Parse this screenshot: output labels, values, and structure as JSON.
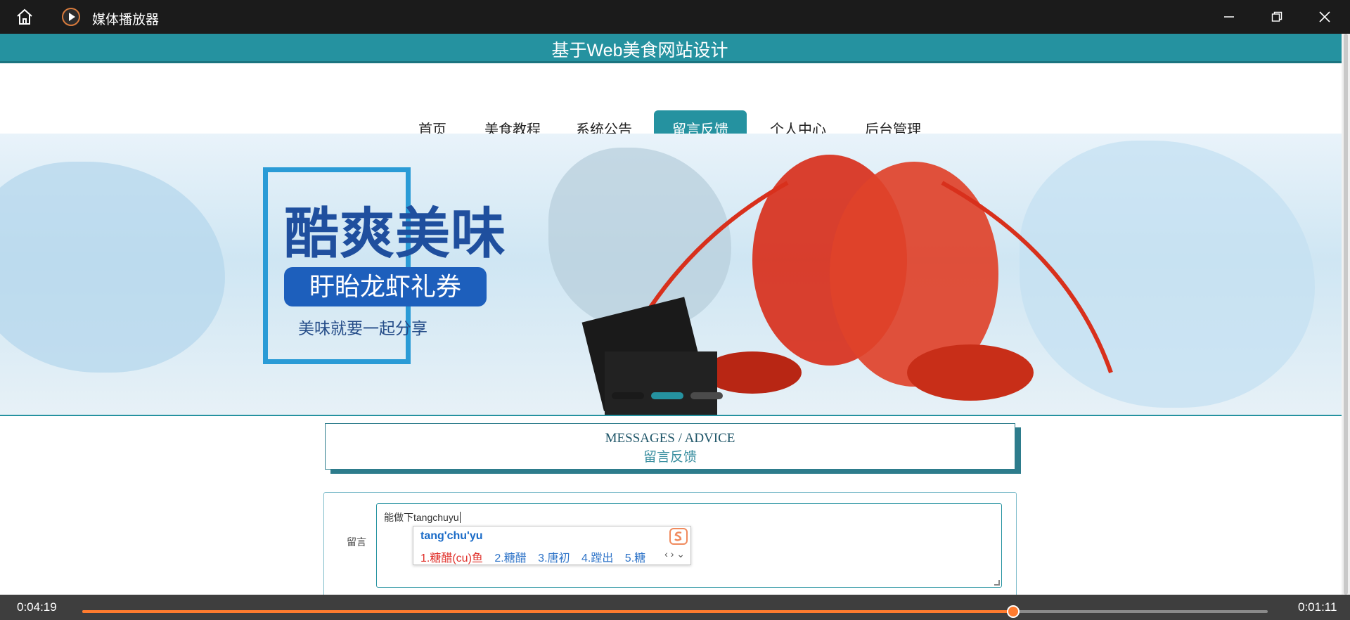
{
  "window": {
    "title": "媒体播放器",
    "minimize_icon": "minimize-icon",
    "maximize_icon": "restore-icon",
    "close_icon": "close-icon"
  },
  "site": {
    "title": "基于Web美食网站设计",
    "accent_color": "#2592a0"
  },
  "nav": {
    "items": [
      {
        "label": "首页"
      },
      {
        "label": "美食教程"
      },
      {
        "label": "系统公告"
      },
      {
        "label": "留言反馈",
        "active": true
      },
      {
        "label": "个人中心"
      },
      {
        "label": "后台管理"
      }
    ]
  },
  "banner": {
    "headline": "酷爽美味",
    "subhead": "盱眙龙虾礼券",
    "tagline": "美味就要一起分享"
  },
  "section": {
    "title_en": "MESSAGES / ADVICE",
    "title_zh": "留言反馈"
  },
  "form": {
    "label": "留言",
    "value": "能做下tangchuyu"
  },
  "ime": {
    "pinyin": "tang'chu'yu",
    "candidates": [
      {
        "num": "1.",
        "text": "糖醋(cu)鱼",
        "selected": true
      },
      {
        "num": "2.",
        "text": "糖醋"
      },
      {
        "num": "3.",
        "text": "唐初"
      },
      {
        "num": "4.",
        "text": "蹚出"
      },
      {
        "num": "5.",
        "text": "糖"
      }
    ],
    "logo_icon": "sogou-icon",
    "arrows_icon": "page-arrows-icon"
  },
  "player": {
    "elapsed": "0:04:19",
    "remaining": "0:01:11",
    "progress": 0.785,
    "accent": "#ff7b2e"
  }
}
